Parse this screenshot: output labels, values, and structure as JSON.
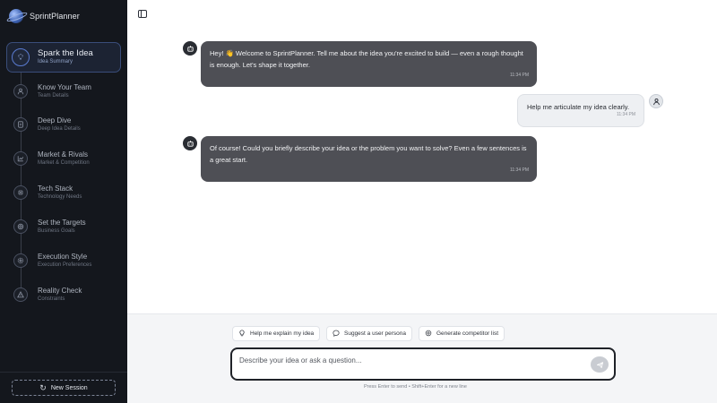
{
  "app": {
    "name": "SprintPlanner"
  },
  "sidebar": {
    "steps": [
      {
        "title": "Spark the Idea",
        "subtitle": "Idea Summary",
        "icon": "lightbulb-icon",
        "active": true
      },
      {
        "title": "Know Your Team",
        "subtitle": "Team Details",
        "icon": "person-icon",
        "active": false
      },
      {
        "title": "Deep Dive",
        "subtitle": "Deep Idea Details",
        "icon": "document-icon",
        "active": false
      },
      {
        "title": "Market & Rivals",
        "subtitle": "Market & Competition",
        "icon": "chart-icon",
        "active": false
      },
      {
        "title": "Tech Stack",
        "subtitle": "Technology Needs",
        "icon": "cpu-icon",
        "active": false
      },
      {
        "title": "Set the Targets",
        "subtitle": "Business Goals",
        "icon": "target-icon",
        "active": false
      },
      {
        "title": "Execution Style",
        "subtitle": "Execution Preferences",
        "icon": "gear-icon",
        "active": false
      },
      {
        "title": "Reality Check",
        "subtitle": "Constraints",
        "icon": "warning-icon",
        "active": false
      }
    ],
    "new_session_label": "New Session"
  },
  "messages": [
    {
      "role": "bot",
      "text": "Hey! 👋 Welcome to SprintPlanner. Tell me about the idea you're excited to build — even a rough thought is enough. Let's shape it together.",
      "time": "11:34 PM"
    },
    {
      "role": "user",
      "text": "Help me articulate my idea clearly.",
      "time": "11:34 PM"
    },
    {
      "role": "bot",
      "text": "Of course! Could you briefly describe your idea or the problem you want to solve? Even a few sentences is a great start.",
      "time": "11:34 PM"
    }
  ],
  "suggestions": [
    {
      "label": "Help me explain my idea",
      "icon": "lightbulb-icon"
    },
    {
      "label": "Suggest a user persona",
      "icon": "chat-bubble-icon"
    },
    {
      "label": "Generate competitor list",
      "icon": "target-icon"
    }
  ],
  "composer": {
    "placeholder": "Describe your idea or ask a question...",
    "hint": "Press Enter to send • Shift+Enter for a new line"
  },
  "colors": {
    "sidebar_bg": "#14171d",
    "bot_bubble": "#4e4f55",
    "active_step_border": "#3a4d7a"
  }
}
